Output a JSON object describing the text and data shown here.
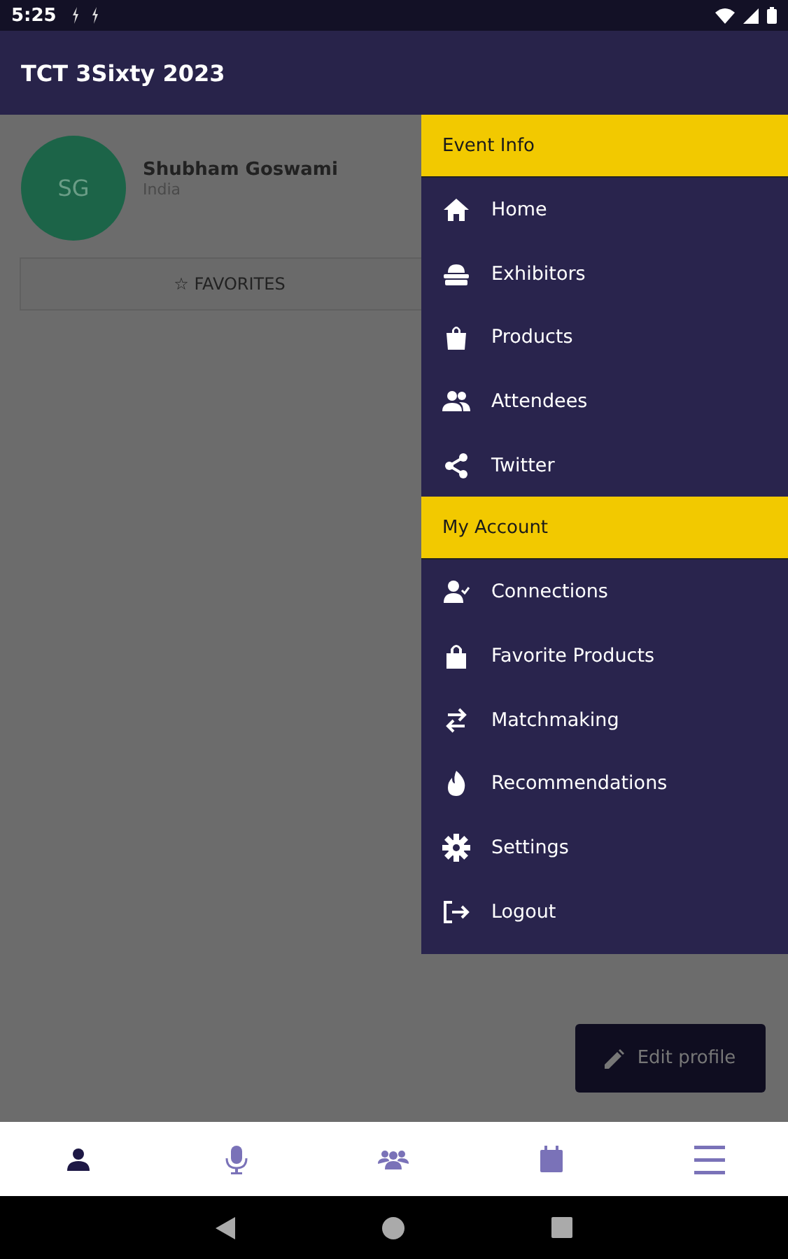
{
  "status_bar": {
    "time": "5:25"
  },
  "app_bar": {
    "title": "TCT 3Sixty 2023"
  },
  "profile": {
    "initials": "SG",
    "name": "Shubham Goswami",
    "country": "India"
  },
  "favorites_tab": {
    "icon": "☆",
    "label": "FAVORITES"
  },
  "edit_button": {
    "label": "Edit profile"
  },
  "drawer": {
    "sections": [
      {
        "title": "Event Info",
        "items": [
          {
            "label": "Home",
            "kind": "home"
          },
          {
            "label": "Exhibitors",
            "kind": "exhibitors"
          },
          {
            "label": "Products",
            "kind": "bag"
          },
          {
            "label": "Attendees",
            "kind": "people"
          },
          {
            "label": "Twitter",
            "kind": "share"
          }
        ]
      },
      {
        "title": "My Account",
        "items": [
          {
            "label": "Connections",
            "kind": "user-check"
          },
          {
            "label": "Favorite Products",
            "kind": "lock-bag"
          },
          {
            "label": "Matchmaking",
            "kind": "swap"
          },
          {
            "label": "Recommendations",
            "kind": "fire"
          },
          {
            "label": "Settings",
            "kind": "gear"
          },
          {
            "label": "Logout",
            "kind": "logout"
          }
        ]
      }
    ]
  },
  "bottom_nav": [
    {
      "kind": "person",
      "selected": true
    },
    {
      "kind": "mic",
      "selected": false
    },
    {
      "kind": "group",
      "selected": false
    },
    {
      "kind": "calendar",
      "selected": false
    },
    {
      "kind": "menu",
      "selected": false
    }
  ]
}
